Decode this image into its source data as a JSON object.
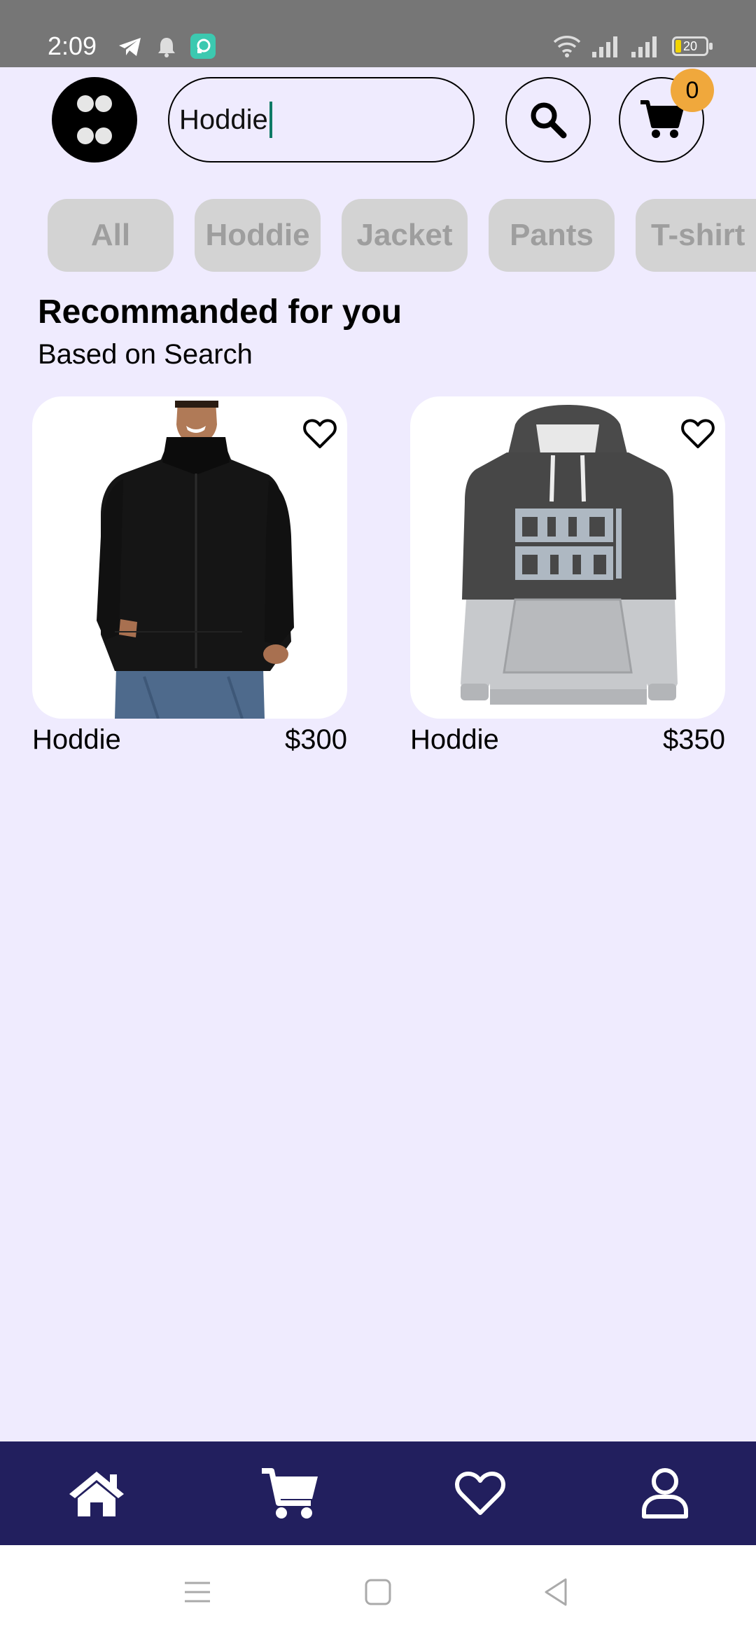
{
  "status_bar": {
    "time": "2:09",
    "battery": "20",
    "icons": [
      "telegram-icon",
      "notification-bell-icon",
      "app-notification-icon",
      "wifi-icon",
      "signal-icon",
      "signal-icon",
      "battery-icon"
    ]
  },
  "header": {
    "menu_icon": "grid-dots-icon",
    "search_value": "Hoddie",
    "search_icon": "search-icon",
    "cart_icon": "cart-icon",
    "cart_count": "0"
  },
  "categories": [
    "All",
    "Hoddie",
    "Jacket",
    "Pants",
    "T-shirt"
  ],
  "section": {
    "title": "Recommanded for you",
    "subtitle": "Based on Search"
  },
  "products": [
    {
      "name": "Hoddie",
      "price": "$300",
      "favorite_icon": "heart-outline-icon"
    },
    {
      "name": "Hoddie",
      "price": "$350",
      "favorite_icon": "heart-outline-icon"
    }
  ],
  "bottom_nav": [
    {
      "icon": "home-icon"
    },
    {
      "icon": "cart-icon"
    },
    {
      "icon": "heart-outline-icon"
    },
    {
      "icon": "user-icon"
    }
  ],
  "system_nav": [
    "menu-icon",
    "home-square-icon",
    "back-icon"
  ],
  "colors": {
    "background": "#EFEBFE",
    "bottom_nav": "#221F5E",
    "badge": "#F0A83C",
    "chip": "#D3D3D3",
    "chip_text": "#9E9E9E",
    "caret": "#0f7a66"
  }
}
